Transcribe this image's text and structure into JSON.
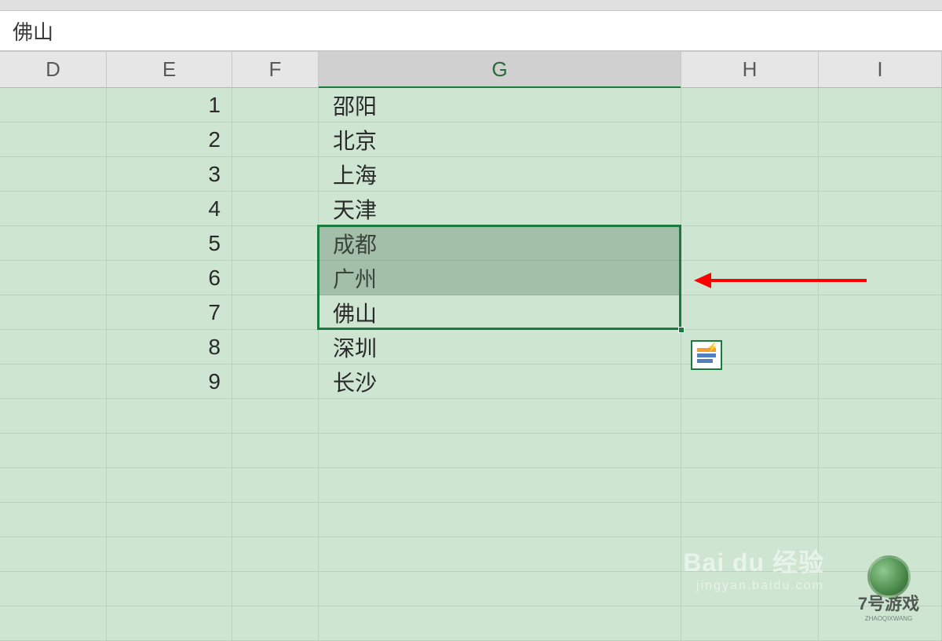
{
  "formula_bar": {
    "value": "佛山"
  },
  "columns": [
    {
      "label": "D",
      "cls": "col-D",
      "selected": false
    },
    {
      "label": "E",
      "cls": "col-E",
      "selected": false
    },
    {
      "label": "F",
      "cls": "col-F",
      "selected": false
    },
    {
      "label": "G",
      "cls": "col-G",
      "selected": true
    },
    {
      "label": "H",
      "cls": "col-H",
      "selected": false
    },
    {
      "label": "I",
      "cls": "col-I",
      "selected": false
    }
  ],
  "rows": [
    {
      "E": "1",
      "G": "邵阳"
    },
    {
      "E": "2",
      "G": "北京"
    },
    {
      "E": "3",
      "G": "上海"
    },
    {
      "E": "4",
      "G": "天津"
    },
    {
      "E": "5",
      "G": "成都"
    },
    {
      "E": "6",
      "G": "广州"
    },
    {
      "E": "7",
      "G": "佛山"
    },
    {
      "E": "8",
      "G": "深圳"
    },
    {
      "E": "9",
      "G": "长沙"
    },
    {
      "E": "",
      "G": ""
    },
    {
      "E": "",
      "G": ""
    },
    {
      "E": "",
      "G": ""
    },
    {
      "E": "",
      "G": ""
    },
    {
      "E": "",
      "G": ""
    },
    {
      "E": "",
      "G": ""
    },
    {
      "E": "",
      "G": ""
    }
  ],
  "selection": {
    "active_cell_content": "佛山",
    "range_rows_g": "5-7",
    "highlighted_rows_g": "5-6"
  },
  "watermark": {
    "brand": "Bai du 经验",
    "sub": "jingyan.baidu.com",
    "game_label": "7号游戏",
    "game_sub": "ZHAOQIXWANG"
  }
}
